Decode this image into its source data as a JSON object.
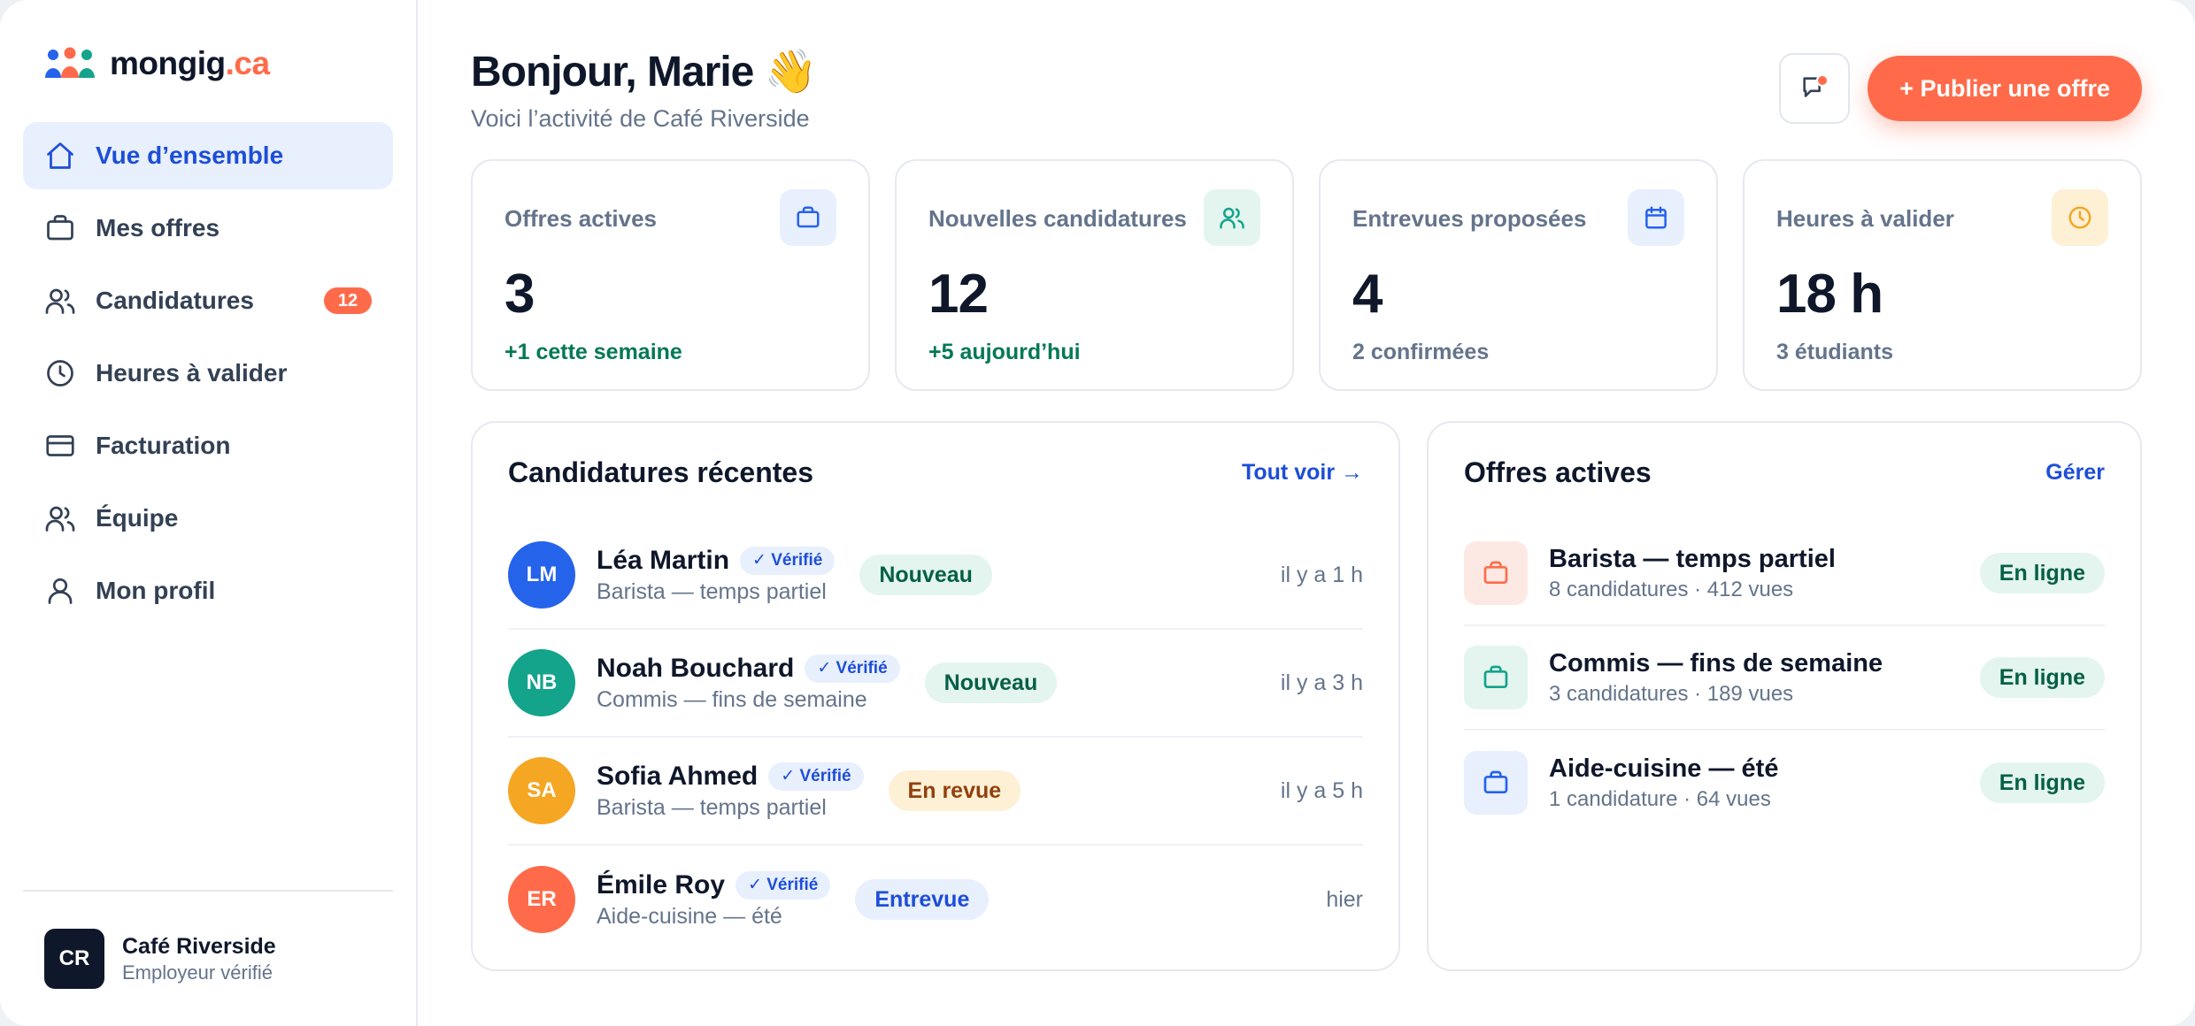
{
  "brand": {
    "name": "mongig",
    "tld": ".ca"
  },
  "sidebar": {
    "items": [
      {
        "label": "Vue d’ensemble",
        "icon": "home-icon"
      },
      {
        "label": "Mes offres",
        "icon": "briefcase-icon"
      },
      {
        "label": "Candidatures",
        "icon": "users-icon",
        "badge": "12"
      },
      {
        "label": "Heures à valider",
        "icon": "clock-icon"
      },
      {
        "label": "Facturation",
        "icon": "credit-card-icon"
      },
      {
        "label": "Équipe",
        "icon": "team-icon"
      },
      {
        "label": "Mon profil",
        "icon": "user-icon"
      }
    ],
    "footer": {
      "initials": "CR",
      "name": "Café Riverside",
      "subtitle": "Employeur vérifié"
    }
  },
  "header": {
    "greeting": "Bonjour, Marie 👋",
    "subtitle": "Voici l’activité de Café Riverside",
    "publish_label": "+ Publier une offre"
  },
  "stats": [
    {
      "label": "Offres actives",
      "value": "3",
      "note": "+1 cette semaine"
    },
    {
      "label": "Nouvelles candidatures",
      "value": "12",
      "note": "+5 aujourd’hui"
    },
    {
      "label": "Entrevues proposées",
      "value": "4",
      "note": "2 confirmées"
    },
    {
      "label": "Heures à valider",
      "value": "18 h",
      "note": "3 étudiants"
    }
  ],
  "applications": {
    "title": "Candidatures récentes",
    "link": "Tout voir →",
    "rows": [
      {
        "initials": "LM",
        "name": "Léa Martin",
        "verified": "✓ Vérifié",
        "job": "Barista — temps partiel",
        "status": "Nouveau",
        "time": "il y a 1 h"
      },
      {
        "initials": "NB",
        "name": "Noah Bouchard",
        "verified": "✓ Vérifié",
        "job": "Commis — fins de semaine",
        "status": "Nouveau",
        "time": "il y a 3 h"
      },
      {
        "initials": "SA",
        "name": "Sofia Ahmed",
        "verified": "✓ Vérifié",
        "job": "Barista — temps partiel",
        "status": "En revue",
        "time": "il y a 5 h"
      },
      {
        "initials": "ER",
        "name": "Émile Roy",
        "verified": "✓ Vérifié",
        "job": "Aide-cuisine — été",
        "status": "Entrevue",
        "time": "hier"
      }
    ]
  },
  "offers": {
    "title": "Offres actives",
    "link": "Gérer",
    "rows": [
      {
        "title": "Barista — temps partiel",
        "meta": "8 candidatures · 412 vues",
        "status": "En ligne"
      },
      {
        "title": "Commis — fins de semaine",
        "meta": "3 candidatures · 189 vues",
        "status": "En ligne"
      },
      {
        "title": "Aide-cuisine — été",
        "meta": "1 candidature · 64 vues",
        "status": "En ligne"
      }
    ]
  },
  "colors": {
    "accent": "#ff6b4a",
    "primary": "#1d4ed8",
    "avatar_lm": "#2563eb",
    "avatar_nb": "#14a38b",
    "avatar_sa": "#f5a623",
    "avatar_er": "#ff6b4a"
  }
}
